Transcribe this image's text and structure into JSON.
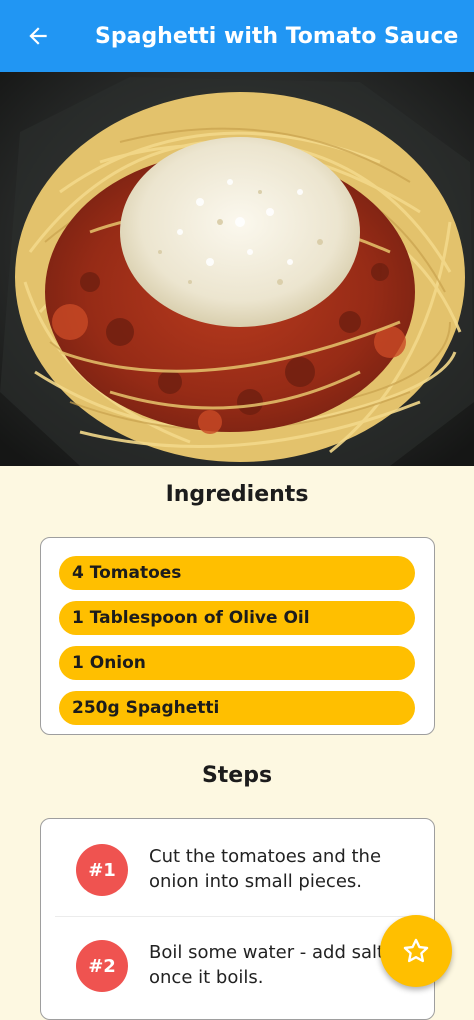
{
  "appbar": {
    "title": "Spaghetti with Tomato Sauce",
    "back_icon": "arrow-left-icon"
  },
  "hero": {
    "image_icon": "meal-photo"
  },
  "ingredients": {
    "heading": "Ingredients",
    "items": [
      "4 Tomatoes",
      "1 Tablespoon of Olive Oil",
      "1 Onion",
      "250g Spaghetti"
    ]
  },
  "steps": {
    "heading": "Steps",
    "items": [
      {
        "badge": "#1",
        "text": "Cut the tomatoes and the onion into small pieces."
      },
      {
        "badge": "#2",
        "text": "Boil some water - add salt to it once it boils."
      }
    ]
  },
  "fab": {
    "icon": "star-outline-icon"
  },
  "colors": {
    "appbar": "#2196f3",
    "pill": "#ffbf00",
    "badge": "#ef5350",
    "background": "#fdf8e1"
  }
}
